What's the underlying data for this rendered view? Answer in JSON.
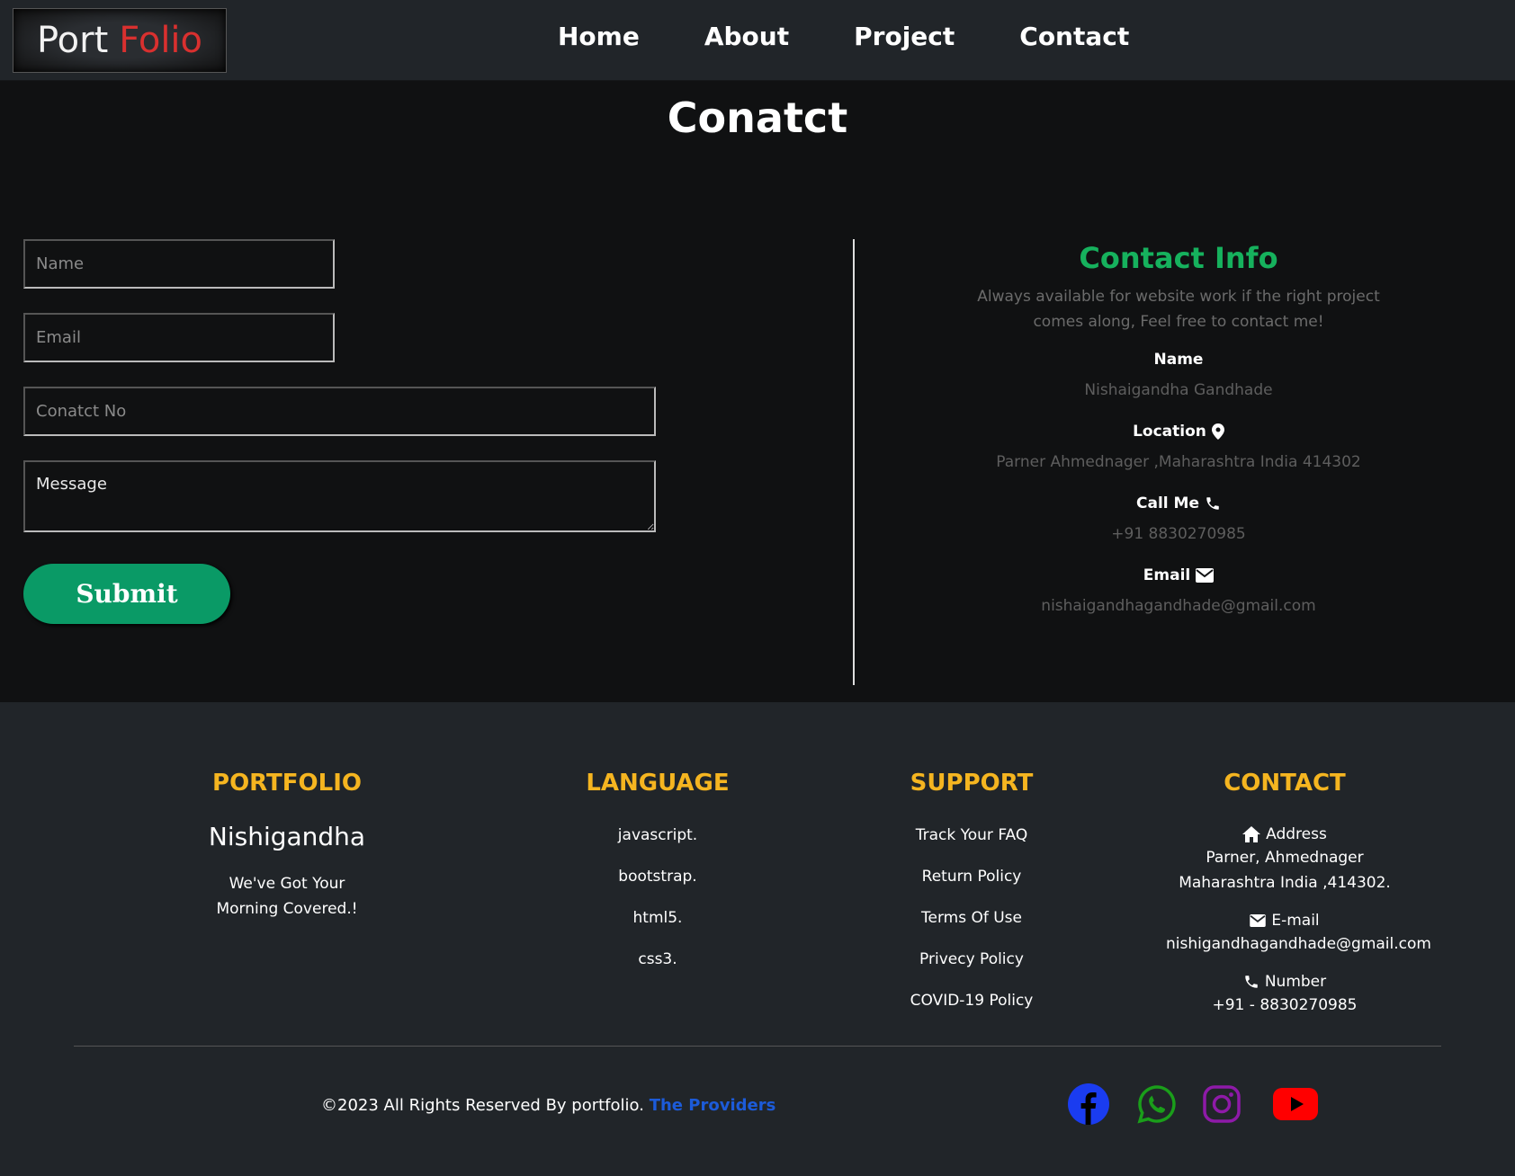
{
  "nav": {
    "logo_part1": "Port",
    "logo_part2": "Folio",
    "items": [
      "Home",
      "About",
      "Project",
      "Contact"
    ]
  },
  "contact": {
    "title": "Conatct",
    "form": {
      "name_placeholder": "Name",
      "email_placeholder": "Email",
      "phone_placeholder": "Conatct No",
      "message_placeholder": "Message",
      "submit_label": "Submit"
    },
    "info": {
      "title": "Contact Info",
      "description": "Always available for website work if the right project comes along, Feel free to contact me!",
      "name_label": "Name",
      "name_value": "Nishaigandha Gandhade",
      "location_label": "Location",
      "location_value": "Parner Ahmednager ,Maharashtra India 414302",
      "call_label": "Call Me",
      "call_value": "+91 8830270985",
      "email_label": "Email",
      "email_value": "nishaigandhagandhade@gmail.com"
    }
  },
  "footer": {
    "portfolio": {
      "heading": "PORTFOLIO",
      "name": "Nishigandha",
      "tagline_line1": "We've Got Your",
      "tagline_line2": "Morning Covered.!"
    },
    "language": {
      "heading": "LANGUAGE",
      "items": [
        "javascript.",
        "bootstrap.",
        "html5.",
        "css3."
      ]
    },
    "support": {
      "heading": "SUPPORT",
      "items": [
        "Track Your FAQ",
        "Return Policy",
        "Terms Of Use",
        "Privecy Policy",
        "COVID-19 Policy"
      ]
    },
    "contact": {
      "heading": "CONTACT",
      "address_label": "Address",
      "address_line1": "Parner, Ahmednager",
      "address_line2": "Maharashtra India ,414302.",
      "email_label": "E-mail",
      "email_value": "nishigandhagandhade@gmail.com",
      "number_label": "Number",
      "number_value": "+91 - 8830270985"
    },
    "copyright": "©2023 All Rights Reserved By portfolio.",
    "providers": "The Providers",
    "colors": {
      "heading": "#f5b520",
      "accent_green": "#16b15d",
      "submit_green": "#0a9a66",
      "facebook": "#1a3cf0",
      "whatsapp": "#1a9e1a",
      "instagram": "#8e1aa8",
      "youtube": "#ff0000"
    }
  }
}
